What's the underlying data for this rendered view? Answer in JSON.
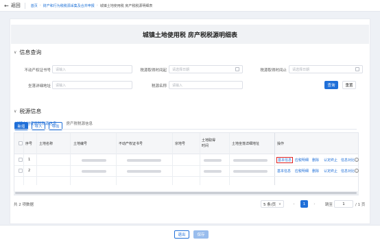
{
  "topbar": {
    "back_label": "返回",
    "breadcrumb": [
      "首页",
      "财产和行为税税源采集及合并申报",
      "城镇土地使用税 房产税税源明细表"
    ]
  },
  "page_title": "城镇土地使用税 房产税税源明细表",
  "query": {
    "section_title": "信息查询",
    "fields": {
      "cert_label": "不动产权证书号",
      "cert_placeholder": "请输入",
      "start_label": "税源取得时间起",
      "start_placeholder": "请选择日期",
      "end_label": "税源取得时间止",
      "end_placeholder": "请选择日期",
      "addr_label": "坐落详细地址",
      "addr_placeholder": "请输入",
      "tax_label": "税源名称",
      "tax_placeholder": "请输入"
    },
    "query_button": "查询",
    "reset_button": "重置"
  },
  "source": {
    "section_title": "税源信息",
    "add_button": "新增",
    "import_button": "导入",
    "export_button": "导出",
    "tabs": [
      "城镇土地使用税税源信息",
      "房产税税源信息"
    ]
  },
  "table": {
    "columns": [
      "序号",
      "土地名称",
      "土地编号",
      "不动产权证书号",
      "宗地号",
      "土地取得时间",
      "土地坐落详细地址",
      "操作"
    ],
    "rows": [
      {
        "index": "1",
        "ops": [
          "基本信息",
          "应税明细",
          "删除",
          "认定终止",
          "信息对比"
        ]
      },
      {
        "index": "2",
        "ops": [
          "基本信息",
          "应税明细",
          "删除",
          "认定终止",
          "信息对比"
        ]
      }
    ]
  },
  "pagination": {
    "total": "共 2 项数据",
    "page_size": "5 条/页",
    "current_page": "1",
    "jump_label": "跳至",
    "jump_value": "1",
    "page_count": "/ 1 页"
  },
  "footer": {
    "exit_button": "退出",
    "save_button": "保存"
  }
}
